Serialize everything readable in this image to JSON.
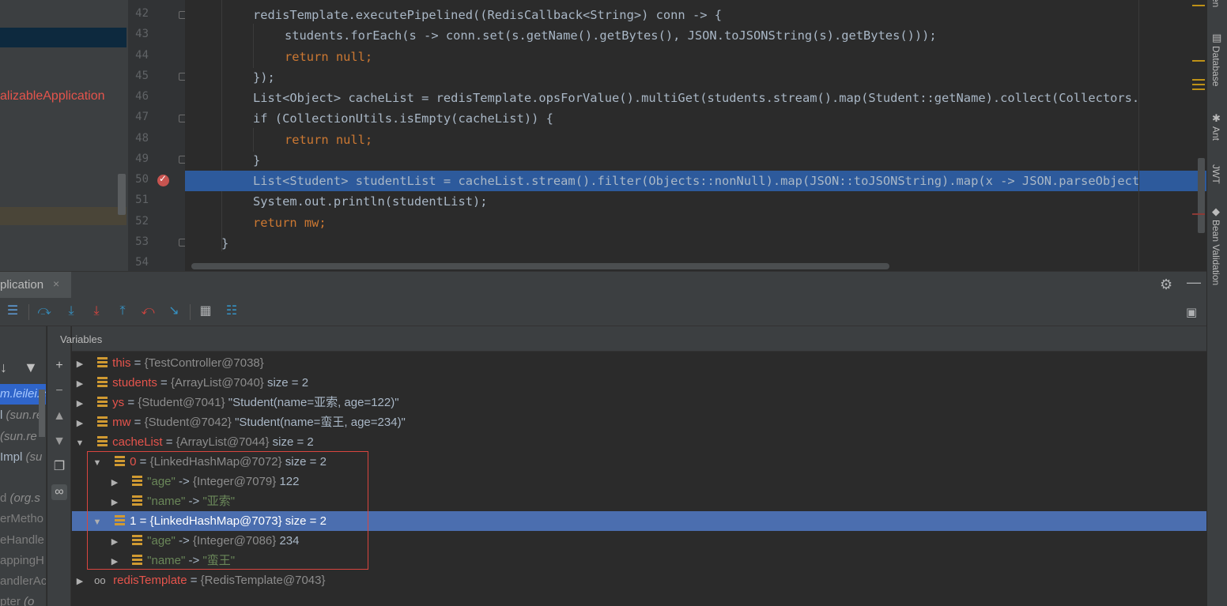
{
  "project": {
    "item": "alizableApplication"
  },
  "gutter": {
    "lines": [
      "42",
      "43",
      "44",
      "45",
      "46",
      "47",
      "48",
      "49",
      "50",
      "51",
      "52",
      "53",
      "54"
    ]
  },
  "code": [
    {
      "t": "redisTemplate.executePipelined((RedisCallback<String>) conn -> {"
    },
    {
      "t": "students.forEach(s -> conn.set(s.getName().getBytes(), JSON.toJSONString(s).getBytes()));"
    },
    {
      "t": "return null;"
    },
    {
      "t": "});"
    },
    {
      "t": "List<Object> cacheList = redisTemplate.opsForValue().multiGet(students.stream().map(Student::getName).collect(Collectors."
    },
    {
      "t": "if (CollectionUtils.isEmpty(cacheList)) {"
    },
    {
      "t": "return null;"
    },
    {
      "t": "}"
    },
    {
      "t": "List<Student> studentList = cacheList.stream().filter(Objects::nonNull).map(JSON::toJSONString).map(x -> JSON.parseObject"
    },
    {
      "t": "System.out.println(studentList);"
    },
    {
      "t": "return mw;"
    },
    {
      "t": "}"
    },
    {
      "t": ""
    }
  ],
  "right_tools": {
    "database": "Database",
    "ant": "Ant",
    "jwt": "JWT",
    "bean_validation": "Bean Validation",
    "top_fragment": "en"
  },
  "debug": {
    "tab_label": "plication",
    "close_glyph": "×",
    "variables_title": "Variables"
  },
  "frames": [
    {
      "name": "m.leilei.c",
      "pkg": ""
    },
    {
      "name": "l ",
      "pkg": "(sun.re"
    },
    {
      "name": " ",
      "pkg": "(sun.re"
    },
    {
      "name": "Impl ",
      "pkg": "(su"
    },
    {
      "name": "",
      "pkg": ""
    },
    {
      "name": "d ",
      "pkg": "(org.s"
    },
    {
      "name": "erMetho",
      "pkg": ""
    },
    {
      "name": "eHandle",
      "pkg": ""
    },
    {
      "name": "appingH",
      "pkg": ""
    },
    {
      "name": "andlerAc",
      "pkg": ""
    },
    {
      "name": "pter ",
      "pkg": "(o"
    }
  ],
  "variables": {
    "this": {
      "name": "this",
      "eq": " = ",
      "type": "{TestController@7038}",
      "extra": ""
    },
    "students": {
      "name": "students",
      "eq": " = ",
      "type": "{ArrayList@7040}",
      "extra": "  size = 2"
    },
    "ys": {
      "name": "ys",
      "eq": " = ",
      "type": "{Student@7041}",
      "extra": " \"Student(name=亚索, age=122)\""
    },
    "mw": {
      "name": "mw",
      "eq": " = ",
      "type": "{Student@7042}",
      "extra": " \"Student(name=蛮王, age=234)\""
    },
    "cacheList": {
      "name": "cacheList",
      "eq": " = ",
      "type": "{ArrayList@7044}",
      "extra": "  size = 2"
    },
    "item0": {
      "name": "0",
      "eq": " = ",
      "type": "{LinkedHashMap@7072}",
      "extra": "  size = 2"
    },
    "item0_age": {
      "key": "\"age\"",
      "arrow": " -> ",
      "type": "{Integer@7079}",
      "extra": " 122"
    },
    "item0_name": {
      "key": "\"name\"",
      "arrow": " -> ",
      "value": "\"亚索\""
    },
    "item1": {
      "name": "1",
      "eq": " = ",
      "type": "{LinkedHashMap@7073}",
      "extra": "  size = 2"
    },
    "item1_age": {
      "key": "\"age\"",
      "arrow": " -> ",
      "type": "{Integer@7086}",
      "extra": " 234"
    },
    "item1_name": {
      "key": "\"name\"",
      "arrow": " -> ",
      "value": "\"蛮王\""
    },
    "redisTemplate": {
      "name": "redisTemplate",
      "eq": " = ",
      "type": "{RedisTemplate@7043}",
      "extra": ""
    }
  },
  "colors": {
    "accent": "#2d5a9c",
    "selection": "#4b6eaf",
    "breakpoint": "#c75450",
    "highlight_box": "#d9453f"
  }
}
